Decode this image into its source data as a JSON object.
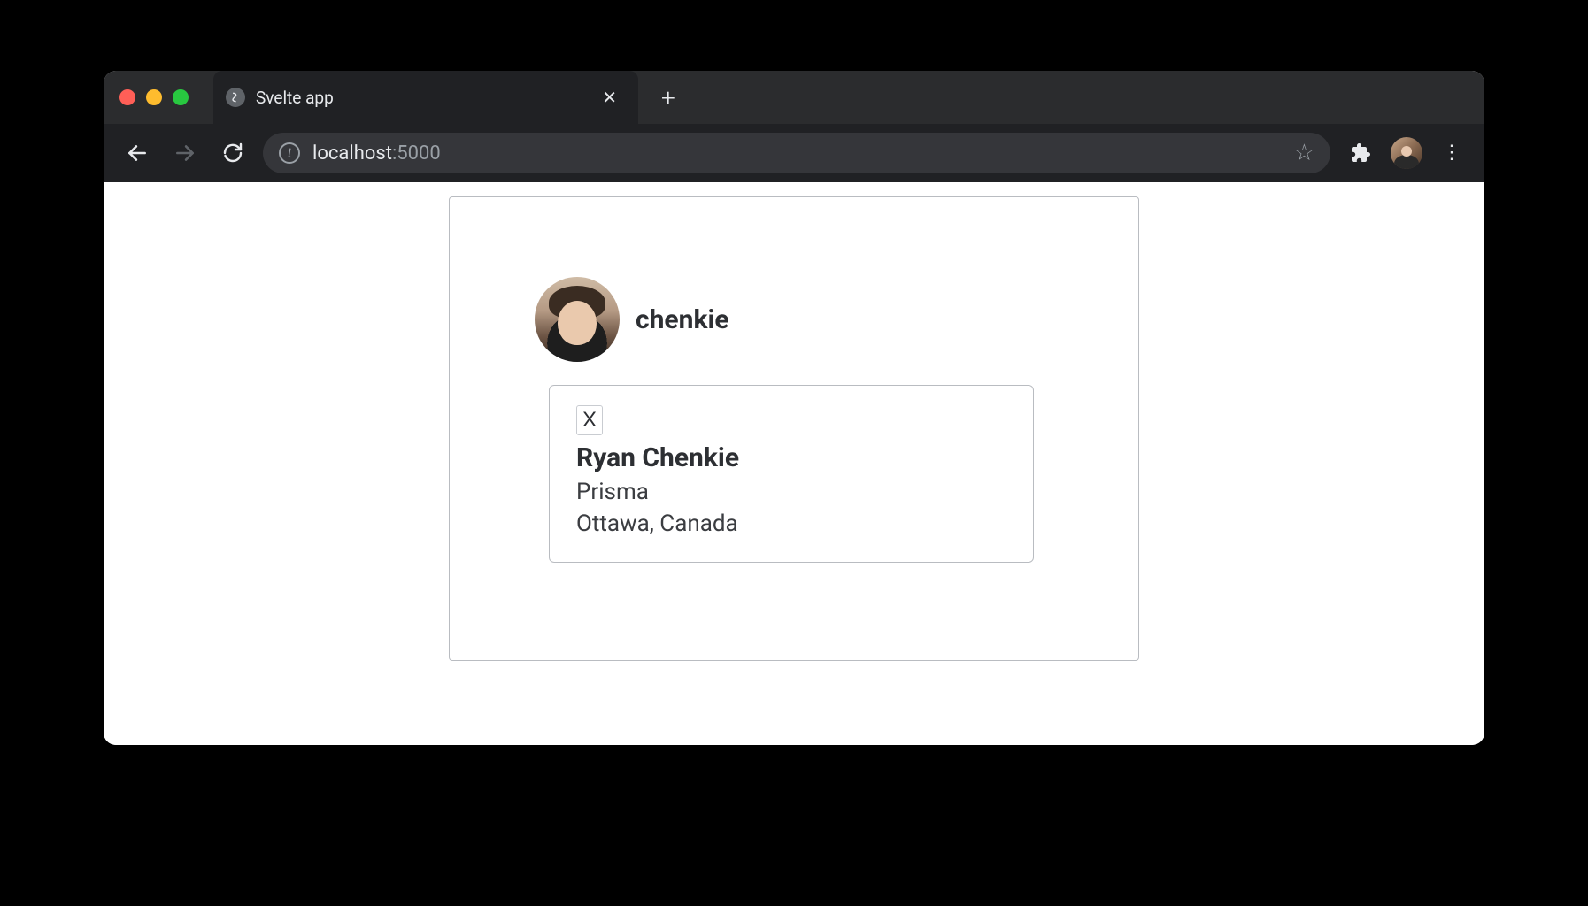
{
  "browser": {
    "tab_title": "Svelte app",
    "url_host": "localhost",
    "url_port": ":5000"
  },
  "page": {
    "handle": "chenkie",
    "close_label": "X",
    "full_name": "Ryan Chenkie",
    "company": "Prisma",
    "location": "Ottawa, Canada"
  }
}
